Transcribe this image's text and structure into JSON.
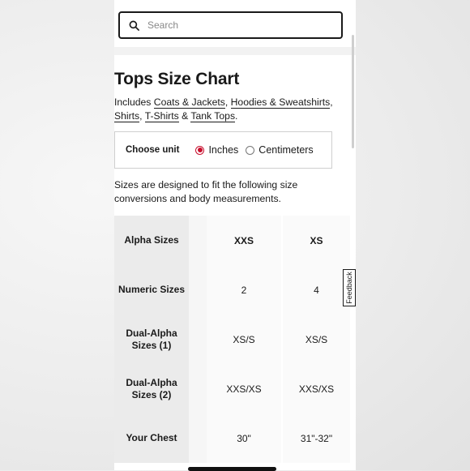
{
  "search": {
    "placeholder": "Search"
  },
  "page": {
    "title": "Tops Size Chart",
    "includes_prefix": "Includes ",
    "categories": [
      "Coats & Jackets",
      "Hoodies & Sweatshirts",
      "Shirts",
      "T-Shirts",
      "Tank Tops"
    ],
    "sep_comma": ", ",
    "sep_amp": " & ",
    "end_period": "."
  },
  "unit": {
    "label": "Choose unit",
    "options": [
      {
        "label": "Inches",
        "selected": true
      },
      {
        "label": "Centimeters",
        "selected": false
      }
    ]
  },
  "intro": "Sizes are designed to fit the following size conversions and body measurements.",
  "table": {
    "rows": [
      {
        "label": "Alpha Sizes",
        "values": [
          "XXS",
          "XS"
        ]
      },
      {
        "label": "Numeric Sizes",
        "values": [
          "2",
          "4"
        ]
      },
      {
        "label": "Dual-Alpha Sizes (1)",
        "values": [
          "XS/S",
          "XS/S"
        ]
      },
      {
        "label": "Dual-Alpha Sizes (2)",
        "values": [
          "XXS/XS",
          "XXS/XS"
        ]
      },
      {
        "label": "Your Chest",
        "values": [
          "30\"",
          "31\"-32\""
        ]
      }
    ]
  },
  "feedback": {
    "label": "Feedback"
  },
  "colors": {
    "accent": "#c8102e",
    "label_cell": "#ebebeb",
    "value_cell": "#fafafa"
  },
  "icons": {
    "search": "search-icon"
  }
}
